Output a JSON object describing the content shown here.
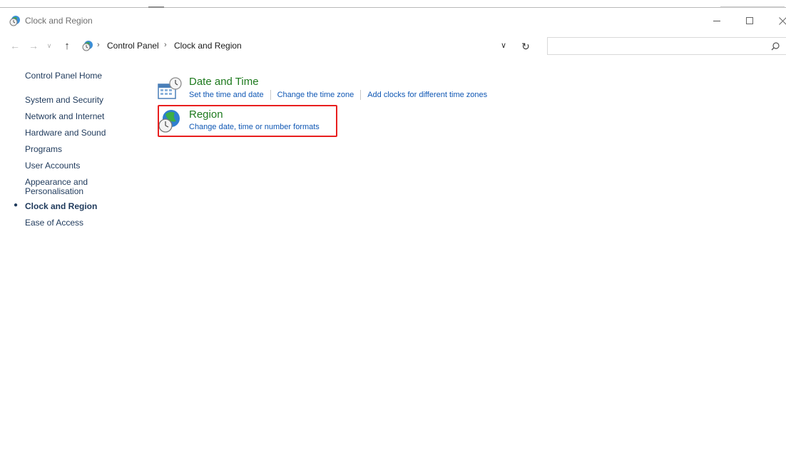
{
  "window": {
    "title": "Clock and Region",
    "controls": {
      "minimize": "—",
      "maximize": "☐",
      "close": "✕"
    }
  },
  "nav": {
    "back_icon": "back-arrow-icon",
    "forward_icon": "forward-arrow-icon",
    "up_icon": "up-arrow-icon",
    "breadcrumb": [
      "Control Panel",
      "Clock and Region"
    ],
    "search_placeholder": ""
  },
  "sidebar": {
    "home": "Control Panel Home",
    "items": [
      {
        "label": "System and Security"
      },
      {
        "label": "Network and Internet"
      },
      {
        "label": "Hardware and Sound"
      },
      {
        "label": "Programs"
      },
      {
        "label": "User Accounts"
      },
      {
        "label": "Appearance and\nPersonalisation"
      },
      {
        "label": "Clock and Region",
        "current": true
      },
      {
        "label": "Ease of Access"
      }
    ]
  },
  "categories": [
    {
      "title": "Date and Time",
      "icon": "calendar-clock-icon",
      "links": [
        "Set the time and date",
        "Change the time zone",
        "Add clocks for different time zones"
      ]
    },
    {
      "title": "Region",
      "icon": "globe-clock-icon",
      "links": [
        "Change date, time or number formats"
      ],
      "highlighted": true
    }
  ],
  "colors": {
    "category_title": "#1e7a1e",
    "link": "#0f57b4",
    "sidebar_text": "#1e395b",
    "highlight": "#e81f1f"
  }
}
